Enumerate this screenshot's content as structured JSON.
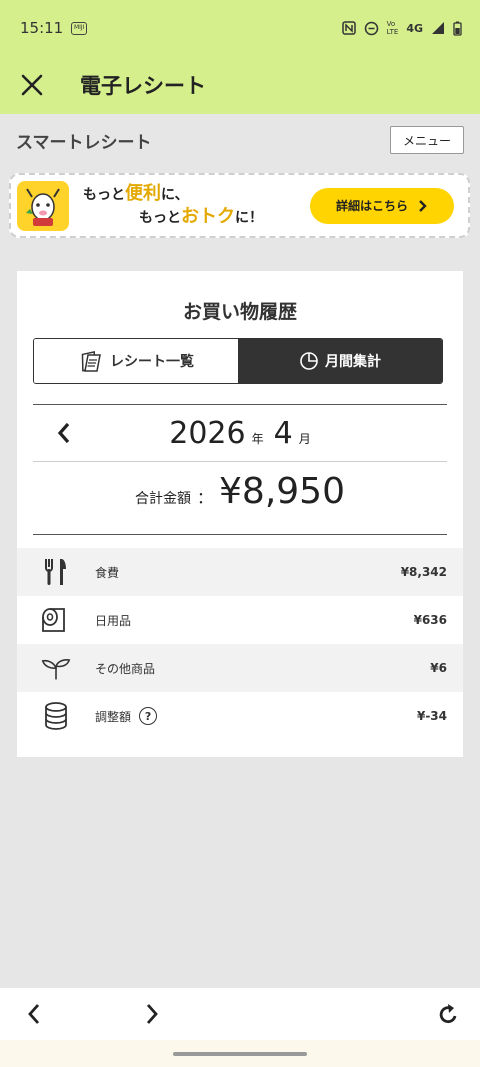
{
  "status_bar": {
    "time": "15:11",
    "notif": "MIJI",
    "lte_top": "Vo",
    "lte_bottom": "LTE",
    "network": "4G"
  },
  "app_bar": {
    "title": "電子レシート"
  },
  "header": {
    "title": "スマートレシート",
    "menu_label": "メニュー"
  },
  "banner": {
    "line1_pre": "もっと",
    "line1_highlight": "便利",
    "line1_post": "に、",
    "line2_pre": "もっと",
    "line2_highlight": "おトク",
    "line2_post": "に！",
    "button_label": "詳細はこちら"
  },
  "card": {
    "title": "お買い物履歴",
    "tabs": [
      {
        "label": "レシート一覧",
        "icon": "receipt-icon",
        "active": false
      },
      {
        "label": "月間集計",
        "icon": "pie-chart-icon",
        "active": true
      }
    ],
    "month": {
      "year": "2026",
      "year_unit": "年",
      "month": "4",
      "month_unit": "月"
    },
    "total": {
      "label": "合計金額",
      "colon": "：",
      "amount": "¥8,950"
    },
    "categories": [
      {
        "name": "食費",
        "value": "¥8,342",
        "icon": "utensils-icon"
      },
      {
        "name": "日用品",
        "value": "¥636",
        "icon": "toilet-roll-icon"
      },
      {
        "name": "その他商品",
        "value": "¥6",
        "icon": "sprout-icon"
      },
      {
        "name": "調整額",
        "value": "¥-34",
        "icon": "coin-stack-icon",
        "help": "?"
      }
    ]
  },
  "colors": {
    "header_bg": "#d5ef8d",
    "accent": "#ffd400",
    "active_tab": "#333333"
  }
}
